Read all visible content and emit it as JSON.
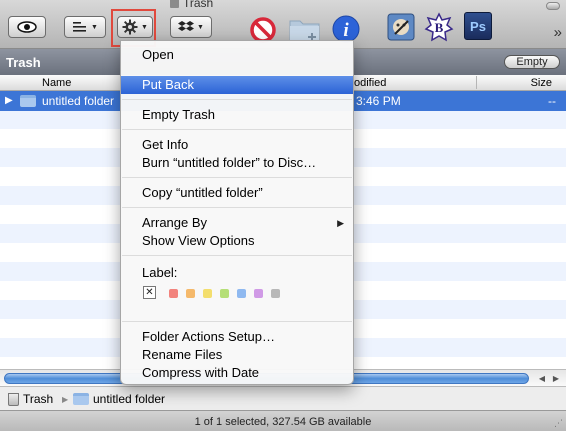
{
  "window": {
    "title": "Trash"
  },
  "toolbar": {
    "icons": [
      "eye-icon",
      "view-options-icon",
      "gear-icon",
      "dropbox-icon",
      "no-entry-icon",
      "new-folder-icon",
      "info-icon",
      "app-icon",
      "bbedit-icon",
      "photoshop-icon"
    ],
    "ps_label": "Ps",
    "bbedit_label": "B",
    "more": "»"
  },
  "pathbar": {
    "title": "Trash",
    "empty_label": "Empty"
  },
  "columns": {
    "name": "Name",
    "modified": "odified",
    "size": "Size"
  },
  "rows": [
    {
      "name": "untitled folder",
      "date": "3:46 PM",
      "size": "--"
    }
  ],
  "menu": {
    "items": {
      "open": "Open",
      "put_back": "Put Back",
      "empty_trash": "Empty Trash",
      "get_info": "Get Info",
      "burn": "Burn “untitled folder” to Disc…",
      "copy": "Copy “untitled folder”",
      "arrange_by": "Arrange By",
      "show_view_options": "Show View Options",
      "folder_actions": "Folder Actions Setup…",
      "rename_files": "Rename Files",
      "compress": "Compress with Date"
    },
    "label_caption": "Label:",
    "label_none": "✕",
    "label_colors": [
      "#f2837d",
      "#f5b96b",
      "#f3de6d",
      "#b5df77",
      "#8fb9f0",
      "#d09ae6",
      "#b8b8b8"
    ]
  },
  "breadcrumbs": [
    "Trash",
    "untitled folder"
  ],
  "status": "1 of 1 selected, 327.54 GB available"
}
